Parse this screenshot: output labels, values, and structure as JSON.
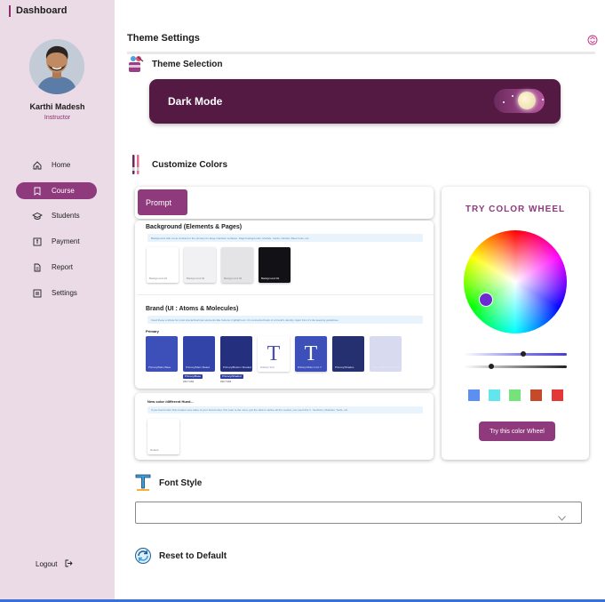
{
  "sidebar": {
    "title": "Dashboard",
    "user": {
      "name": "Karthi Madesh",
      "role": "Instructor"
    },
    "items": [
      {
        "label": "Home",
        "icon": "home-icon",
        "active": false
      },
      {
        "label": "Course",
        "icon": "bookmark-icon",
        "active": true
      },
      {
        "label": "Students",
        "icon": "graduation-cap-icon",
        "active": false
      },
      {
        "label": "Payment",
        "icon": "payment-icon",
        "active": false
      },
      {
        "label": "Report",
        "icon": "document-icon",
        "active": false
      },
      {
        "label": "Settings",
        "icon": "settings-icon",
        "active": false
      }
    ],
    "logout": "Logout"
  },
  "main": {
    "title": "Theme Settings",
    "theme_selection": {
      "heading": "Theme Selection",
      "mode_label": "Dark Mode"
    },
    "customize": {
      "heading": "Customize Colors",
      "prompt_label": "Prompt",
      "background": {
        "title": "Background (Elements & Pages)",
        "note": "Background with a low contrast to the primary for large interface surfaces. Page backgrounds, Modals, Cards, Navbar, Base fonts, etc.",
        "swatches": [
          {
            "label": "Background:01",
            "color": "#ffffff"
          },
          {
            "label": "Background:02",
            "color": "#f1f1f3"
          },
          {
            "label": "Background:03",
            "color": "#e4e4e7"
          },
          {
            "label": "Background:04",
            "color": "#111116"
          }
        ]
      },
      "brand": {
        "title": "Brand (UI : Atoms & Molecules)",
        "note": "Used these a whole for most interactive/input elements like buttons, highlight etc. It's connected back of a brand's identity. Apart from it's tile keeping guidelines.",
        "primary_label": "Primary",
        "swatches": [
          {
            "label": "Primary/Main Base",
            "color": "#3d4fb8",
            "type": "swatch"
          },
          {
            "label": "Primary/Main Slated",
            "color": "#3344a8",
            "type": "swatch",
            "tag": "Primary/Base",
            "sub": "#4F7A84"
          },
          {
            "label": "Primary/Bottom Shaded",
            "color": "#24307e",
            "type": "swatch",
            "tag": "Primary/Shaded",
            "sub": "#4F7A84"
          },
          {
            "label": "Primary/Text",
            "color": "#ffffff",
            "type": "text",
            "glyph": "T"
          },
          {
            "label": "Primary/Main Color T",
            "color": "#3d4fb8",
            "type": "text",
            "glyph": "T"
          },
          {
            "label": "Primary/Shades",
            "color": "#253070",
            "type": "swatch"
          },
          {
            "label": "Primary/Brand Minimal",
            "color": "#d8daf0",
            "type": "swatch"
          }
        ]
      },
      "new_color": {
        "title": "New color /different Hued...",
        "note": "If you found color that creates new value of your brand color, this color is the most, just the dark to define all the neutral, you need this 1 : Sections, Modules, Tools, etc.",
        "swatch_label": "Default"
      }
    },
    "color_wheel": {
      "title": "TRY COLOR WHEEL",
      "button": "Try this color Wheel",
      "hue_slider_value": 0.58,
      "brightness_slider_value": 0.27,
      "chips": [
        "#5b8ff2",
        "#62e6ee",
        "#74e37a",
        "#c44a2a",
        "#e43838"
      ]
    },
    "font_style": {
      "heading": "Font Style",
      "selected": ""
    },
    "reset": {
      "label": "Reset to Default"
    }
  },
  "colors": {
    "accent": "#8e3a7c",
    "dark_card": "#541a44",
    "sidebar_bg": "#eadbe6"
  }
}
